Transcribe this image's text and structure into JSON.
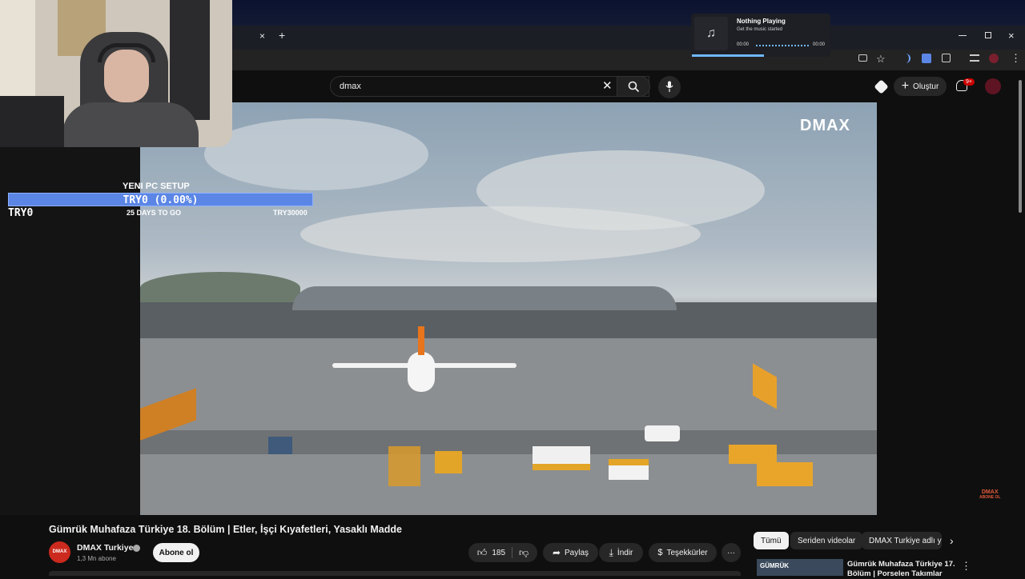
{
  "webcam_overlay": {
    "goal_title": "YENI PC SETUP",
    "goal_progress_text": "TRY0 (0.00%)",
    "goal_progress": 0.0,
    "current_amount": "TRY0",
    "days_left": "25 DAYS TO GO",
    "goal_amount": "TRY30000"
  },
  "media_widget": {
    "title": "Nothing Playing",
    "subtitle": "Get the music started",
    "time_start": "00:00",
    "time_end": "00:00"
  },
  "browser": {
    "close_tab": "×",
    "new_tab": "+"
  },
  "youtube": {
    "search_value": "dmax",
    "create_label": "Oluştur",
    "notif_badge": "9+",
    "channel_watermark": "DMAX",
    "corner_logo": "DMAX",
    "corner_logo_sub": "ABONE OL",
    "video_title": "Gümrük Muhafaza Türkiye 18. Bölüm | Etler, İşçi Kıyafetleri, Yasaklı Madde",
    "channel_name": "DMAX Turkiye",
    "channel_avatar_text": "DMAX",
    "subscribers": "1,3 Mn abone",
    "subscribe_label": "Abone ol",
    "like_count": "185",
    "share_label": "Paylaş",
    "download_label": "İndir",
    "thanks_label": "Teşekkürler",
    "more_label": "···",
    "chips": [
      "Tümü",
      "Seriden videolar",
      "DMAX Turkiye adlı yü"
    ],
    "rec_title_line1": "Gümrük Muhafaza Türkiye 17.",
    "rec_title_line2": "Bölüm | Porselen Takımlar",
    "rec_thumb_text": "GÜMRÜK"
  },
  "colors": {
    "accent_blue": "#5b86e5",
    "yt_red": "#cc0000",
    "bg": "#0f0f0f"
  }
}
